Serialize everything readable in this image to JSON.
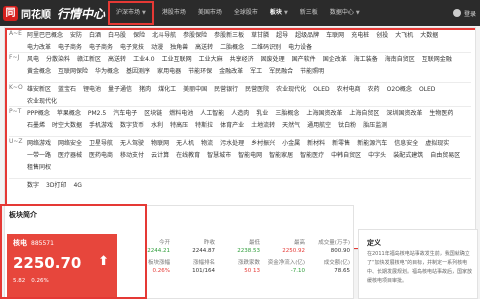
{
  "header": {
    "logo_mark": "同",
    "logo_text": "同花顺",
    "logo_sub": "行情中心",
    "nav": [
      {
        "label": "沪深市场",
        "dropdown": true,
        "highlighted": true
      },
      {
        "label": "港股市场",
        "dropdown": false
      },
      {
        "label": "美国市场",
        "dropdown": false
      },
      {
        "label": "全球股市",
        "dropdown": false
      },
      {
        "label": "板块",
        "dropdown": true,
        "active": true
      },
      {
        "label": "新三板",
        "dropdown": false
      },
      {
        "label": "数据中心",
        "dropdown": true
      }
    ],
    "login": "登录"
  },
  "sectors": [
    {
      "key": "A~E",
      "items": [
        "阿里巴巴概念",
        "安防",
        "白酒",
        "白马股",
        "保险",
        "北斗导航",
        "参股保险",
        "参股新三板",
        "草甘膦",
        "超导",
        "超级品牌",
        "车联网",
        "充电桩",
        "创投",
        "大飞机",
        "大数据",
        "电力改革",
        "电子商务",
        "电子商务",
        "电子竞技",
        "动漫",
        "独角兽",
        "高送转",
        "二胎概念",
        "二维码识别",
        "电力设备"
      ]
    },
    {
      "key": "F~J",
      "items": [
        "风电",
        "分散染料",
        "赣江新区",
        "高送转",
        "工业4.0",
        "工业互联网",
        "工业大麻",
        "共享经济",
        "固废处理",
        "国产软件",
        "国企改革",
        "海工装备",
        "海南自贸区",
        "互联网金融",
        "黄金概念",
        "互联网保险",
        "华为概念",
        "基因测序",
        "家用电器",
        "节能环保",
        "金融改革",
        "军工",
        "军民融合",
        "节能照明"
      ]
    },
    {
      "key": "K~O",
      "items": [
        "雄安新区",
        "蓝宝石",
        "锂电池",
        "量子通信",
        "猪肉",
        "煤化工",
        "美丽中国",
        "民营银行",
        "民营医院",
        "农业现代化",
        "OLED",
        "农村电商",
        "农药",
        "O2O概念",
        "OLED",
        "农业现代化"
      ]
    },
    {
      "key": "P~T",
      "items": [
        "PPP概念",
        "苹果概念",
        "PM2.5",
        "汽车电子",
        "区块链",
        "燃料电池",
        "人工智能",
        "人造肉",
        "乳业",
        "三胎概念",
        "上海国资改革",
        "上海自贸区",
        "深圳国资改革",
        "生物医药",
        "石墨烯",
        "时空大数据",
        "手机游戏",
        "数字货币",
        "水利",
        "特高压",
        "特斯拉",
        "体育产业",
        "土地流转",
        "天然气",
        "通用航空",
        "钛白粉",
        "胎压监测"
      ]
    },
    {
      "key": "U~Z",
      "items": [
        "网络游戏",
        "网络安全",
        "卫星导航",
        "无人驾驶",
        "物联网",
        "无人机",
        "物流",
        "污水处理",
        "乡村振兴",
        "小金属",
        "新材料",
        "新零售",
        "新能源汽车",
        "信息安全",
        "虚拟现实",
        "一带一路",
        "医疗器械",
        "医药电商",
        "移动支付",
        "云计算",
        "在线教育",
        "智慧城市",
        "智能电网",
        "智能家居",
        "智能医疗",
        "中韩自贸区",
        "中字头",
        "装配式建筑",
        "自由贸易区",
        "租售同权"
      ]
    },
    {
      "key": "",
      "items": [
        "数字",
        "3D打印",
        "4G"
      ]
    }
  ],
  "sector_info": {
    "title": "板块简介",
    "name": "核电",
    "code": "885571",
    "price": "2250.70",
    "direction_icon": "up-arrow",
    "change": "5.82",
    "change_pct": "0.26%",
    "stats_rows": [
      {
        "cells": [
          {
            "label": "今开",
            "value": "2244.21",
            "color": "green"
          },
          {
            "label": "昨收",
            "value": "2244.87",
            "color": "default"
          },
          {
            "label": "最低",
            "value": "2238.53",
            "color": "green"
          },
          {
            "label": "最高",
            "value": "2250.92",
            "color": "red"
          },
          {
            "label": "成交量(万手)",
            "value": "800.90",
            "color": "default"
          }
        ]
      },
      {
        "cells": [
          {
            "label": "板块涨幅",
            "value": "0.26%",
            "color": "red"
          },
          {
            "label": "涨幅排名",
            "value": "101/164",
            "color": "default"
          },
          {
            "label": "涨跌家数",
            "value": "50 13",
            "color": "red"
          },
          {
            "label": "资金净流入(亿)",
            "value": "-7.10",
            "color": "green"
          },
          {
            "label": "成交额(亿)",
            "value": "78.65",
            "color": "default"
          }
        ]
      }
    ]
  },
  "definition": {
    "title": "定义",
    "text": "在2011年福岛核电站事故发生前，我国就确立了“加快发展核电”的目标，并制定一系列核电中、长期发展规划。福岛核电站事故后，国家放缓核电项目审批。"
  },
  "colors": {
    "accent": "#e53935",
    "topbar": "#2b2b2b",
    "up": "#e7463c",
    "down": "#2e9d3a"
  }
}
